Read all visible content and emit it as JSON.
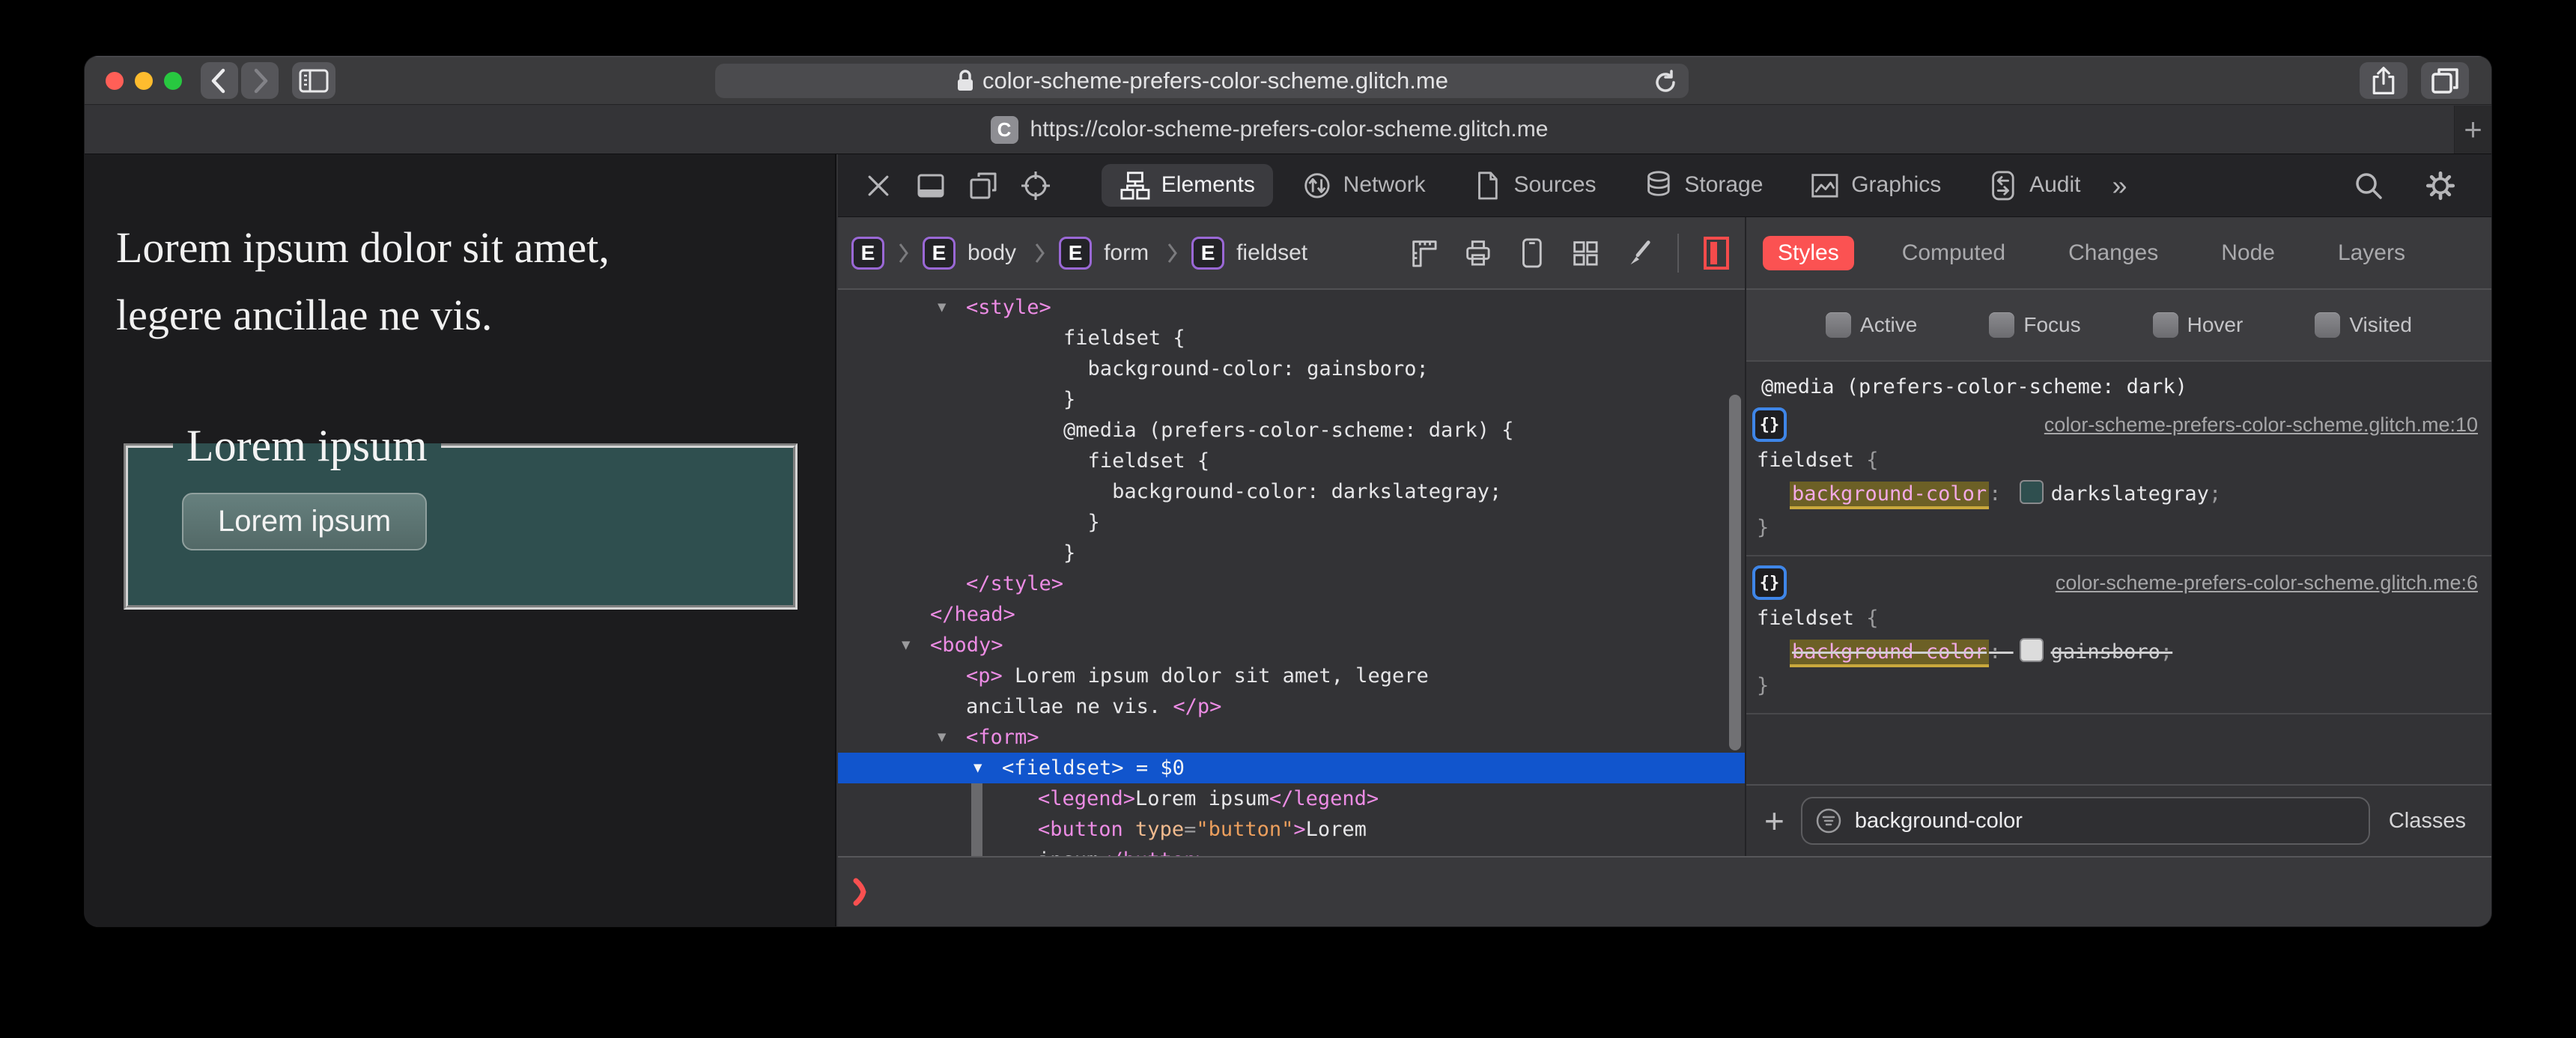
{
  "window": {
    "toolbar": {
      "url": "color-scheme-prefers-color-scheme.glitch.me"
    },
    "tab": {
      "favicon_letter": "C",
      "title": "https://color-scheme-prefers-color-scheme.glitch.me",
      "new_tab_label": "+"
    }
  },
  "page": {
    "paragraph_lines": [
      "Lorem ipsum dolor sit amet,",
      "legere ancillae ne vis."
    ],
    "fieldset_legend": "Lorem ipsum",
    "button_label": "Lorem ipsum",
    "colors": {
      "page_bg": "#1c1c1e",
      "fieldset_bg": "#2f4f4f",
      "button_bg_top": "#66807e",
      "button_bg_bottom": "#536967",
      "button_border": "#90a09e"
    }
  },
  "inspector": {
    "tabs": [
      {
        "label": "Elements",
        "icon": "elements-icon",
        "selected": true
      },
      {
        "label": "Network",
        "icon": "network-icon",
        "selected": false
      },
      {
        "label": "Sources",
        "icon": "sources-icon",
        "selected": false
      },
      {
        "label": "Storage",
        "icon": "storage-icon",
        "selected": false
      },
      {
        "label": "Graphics",
        "icon": "graphics-icon",
        "selected": false
      },
      {
        "label": "Audit",
        "icon": "audit-icon",
        "selected": false
      }
    ],
    "more_tabs_label": "»",
    "breadcrumbs": [
      {
        "badge": "E",
        "label": ""
      },
      {
        "badge": "E",
        "label": "body"
      },
      {
        "badge": "E",
        "label": "form"
      },
      {
        "badge": "E",
        "label": "fieldset"
      }
    ],
    "crumb_tools": [
      "rulers-icon",
      "print-styles-icon",
      "device-icon",
      "grid-overlay-icon",
      "visual-edit-icon",
      "force-appearance-icon"
    ],
    "dom_rows": [
      {
        "indent": 2,
        "expander": "open",
        "parts": [
          {
            "c": "tag",
            "t": "<style>"
          }
        ]
      },
      {
        "indent": 2,
        "parts": [
          {
            "c": "text",
            "t": "        fieldset {"
          }
        ]
      },
      {
        "indent": 2,
        "parts": [
          {
            "c": "text",
            "t": "          background-color: gainsboro;"
          }
        ]
      },
      {
        "indent": 2,
        "parts": [
          {
            "c": "text",
            "t": "        }"
          }
        ]
      },
      {
        "indent": 2,
        "parts": [
          {
            "c": "text",
            "t": "        @media (prefers-color-scheme: dark) {"
          }
        ]
      },
      {
        "indent": 2,
        "parts": [
          {
            "c": "text",
            "t": "          fieldset {"
          }
        ]
      },
      {
        "indent": 2,
        "parts": [
          {
            "c": "text",
            "t": "            background-color: darkslategray;"
          }
        ]
      },
      {
        "indent": 2,
        "parts": [
          {
            "c": "text",
            "t": "          }"
          }
        ]
      },
      {
        "indent": 2,
        "parts": [
          {
            "c": "text",
            "t": "        }"
          }
        ]
      },
      {
        "indent": 2,
        "parts": [
          {
            "c": "tag",
            "t": "</style>"
          }
        ]
      },
      {
        "indent": 1,
        "parts": [
          {
            "c": "tag",
            "t": "</head>"
          }
        ]
      },
      {
        "indent": 1,
        "expander": "open",
        "parts": [
          {
            "c": "tag",
            "t": "<body>"
          }
        ]
      },
      {
        "indent": 2,
        "parts": [
          {
            "c": "tag",
            "t": "<p>"
          },
          {
            "c": "text",
            "t": " Lorem ipsum dolor sit amet, legere"
          }
        ]
      },
      {
        "indent": 2,
        "parts": [
          {
            "c": "text",
            "t": "ancillae ne vis. "
          },
          {
            "c": "tag",
            "t": "</p>"
          }
        ]
      },
      {
        "indent": 2,
        "expander": "open",
        "parts": [
          {
            "c": "tag",
            "t": "<form>"
          }
        ]
      },
      {
        "indent": 3,
        "expander": "open",
        "selected": true,
        "parts": [
          {
            "c": "tag",
            "t": "<fieldset>"
          },
          {
            "c": "punct",
            "t": " = "
          },
          {
            "c": "text",
            "t": "$0"
          }
        ]
      },
      {
        "indent": 4,
        "parts": [
          {
            "c": "tag",
            "t": "<legend>"
          },
          {
            "c": "text",
            "t": "Lorem ipsum"
          },
          {
            "c": "tag",
            "t": "</legend>"
          }
        ]
      },
      {
        "indent": 4,
        "parts": [
          {
            "c": "tag",
            "t": "<button"
          },
          {
            "c": "attr",
            "t": " type"
          },
          {
            "c": "punct",
            "t": "="
          },
          {
            "c": "val",
            "t": "\"button\""
          },
          {
            "c": "tag",
            "t": ">"
          },
          {
            "c": "text",
            "t": "Lorem"
          }
        ]
      },
      {
        "indent": 4,
        "parts": [
          {
            "c": "text",
            "t": "ipsum"
          },
          {
            "c": "tag",
            "t": "</button>"
          }
        ]
      }
    ],
    "sidebar_tabs": [
      {
        "label": "Styles",
        "selected": true
      },
      {
        "label": "Computed",
        "selected": false
      },
      {
        "label": "Changes",
        "selected": false
      },
      {
        "label": "Node",
        "selected": false
      },
      {
        "label": "Layers",
        "selected": false
      }
    ],
    "styles_panel": {
      "pseudo_toggles": [
        "Active",
        "Focus",
        "Hover",
        "Visited"
      ],
      "media_query": "@media (prefers-color-scheme: dark)",
      "rules": [
        {
          "source_link": "color-scheme-prefers-color-scheme.glitch.me:10",
          "selector": "fieldset",
          "property": "background-color",
          "value": "darkslategray",
          "swatch": "#2f4f4f",
          "overridden": false
        },
        {
          "source_link": "color-scheme-prefers-color-scheme.glitch.me:6",
          "selector": "fieldset",
          "property": "background-color",
          "value": "gainsboro",
          "swatch": "#dcdcdc",
          "overridden": true
        }
      ],
      "filter_value": "background-color",
      "classes_label": "Classes",
      "add_label": "+"
    },
    "colors": {
      "selection_blue": "#1155cd",
      "accent_red": "#fb5252",
      "tag_pink": "#ec8ce4",
      "attr_name": "#f0ba8e",
      "attr_value": "#ec9f5d",
      "match_highlight_bg": "#6c6026",
      "match_underline": "#c9a83d",
      "brace_badge_border": "#3f86e8"
    }
  }
}
